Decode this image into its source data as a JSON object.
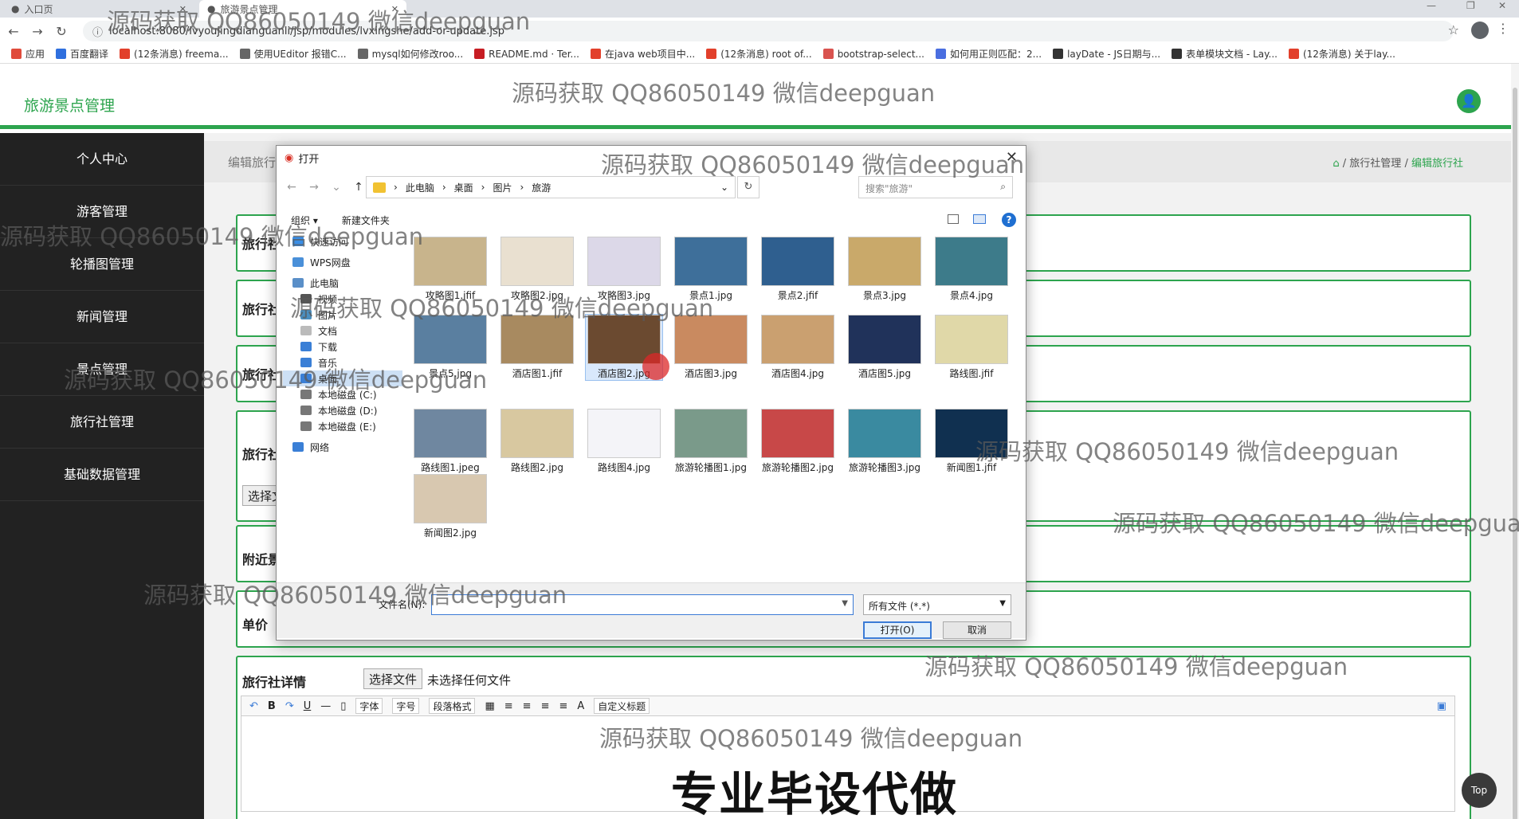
{
  "browser": {
    "tabs": [
      {
        "label": "入口页"
      },
      {
        "label": "旅游景点管理"
      }
    ],
    "url": "localhost:8080/lvyoujingdianguanli/jsp/modules/lvxingshe/add-or-update.jsp",
    "bookmarks": [
      {
        "label": "应用",
        "color": "#e04b3b"
      },
      {
        "label": "百度翻译",
        "color": "#2f6fde"
      },
      {
        "label": "(12条消息) freema...",
        "color": "#e2402b"
      },
      {
        "label": "使用UEditor 报错C...",
        "color": "#666666"
      },
      {
        "label": "mysql如何修改roo...",
        "color": "#666666"
      },
      {
        "label": "README.md · Ter...",
        "color": "#c71d23"
      },
      {
        "label": "在java web项目中...",
        "color": "#e2402b"
      },
      {
        "label": "(12条消息) root of...",
        "color": "#e2402b"
      },
      {
        "label": "bootstrap-select...",
        "color": "#d9534f"
      },
      {
        "label": "如何用正则匹配：2...",
        "color": "#4a6ee0"
      },
      {
        "label": "layDate - JS日期与...",
        "color": "#333333"
      },
      {
        "label": "表单模块文档 - Lay...",
        "color": "#333333"
      },
      {
        "label": "(12条消息) 关于lay...",
        "color": "#e2402b"
      }
    ]
  },
  "app": {
    "title": "旅游景点管理",
    "accent": "#2da44e",
    "sidebar": [
      "个人中心",
      "游客管理",
      "轮播图管理",
      "新闻管理",
      "景点管理",
      "旅行社管理",
      "基础数据管理"
    ],
    "breadcrumb_left": "编辑旅行社",
    "breadcrumb": {
      "sep": "/",
      "parent": "旅行社管理",
      "current": "编辑旅行社"
    },
    "form": {
      "labels": [
        "旅行社",
        "旅行社",
        "旅行社",
        "旅行社",
        "附近景",
        "单价",
        "旅行社详情"
      ],
      "choose_btn_short": "选择文",
      "choose_btn": "选择文件",
      "no_file": "未选择任何文件",
      "editor": {
        "font": "字体",
        "size": "字号",
        "para": "段落格式",
        "custom": "自定义标题"
      }
    },
    "top_btn": "Top",
    "promo": "专业毕设代做"
  },
  "dialog": {
    "title": "打开",
    "path": [
      "此电脑",
      "桌面",
      "图片",
      "旅游"
    ],
    "search_placeholder": "搜索\"旅游\"",
    "organize": "组织 ▾",
    "new_folder": "新建文件夹",
    "tree": [
      "快速访问",
      "WPS网盘",
      "此电脑",
      "视频",
      "图片",
      "文档",
      "下载",
      "音乐",
      "桌面",
      "本地磁盘 (C:)",
      "本地磁盘 (D:)",
      "本地磁盘 (E:)",
      "网络"
    ],
    "files": [
      {
        "name": "攻略图1.jfif",
        "color": "#c8b48c"
      },
      {
        "name": "攻略图2.jpg",
        "color": "#e9e0d0"
      },
      {
        "name": "攻略图3.jpg",
        "color": "#dcd8e8"
      },
      {
        "name": "景点1.jpg",
        "color": "#3e6f9a"
      },
      {
        "name": "景点2.jfif",
        "color": "#2f5f8f"
      },
      {
        "name": "景点3.jpg",
        "color": "#c9a96a"
      },
      {
        "name": "景点4.jpg",
        "color": "#3d7b8a"
      },
      {
        "name": "景点5.jpg",
        "color": "#5a7fa0"
      },
      {
        "name": "酒店图1.jfif",
        "color": "#a88a60"
      },
      {
        "name": "酒店图2.jpg",
        "color": "#6b4a30"
      },
      {
        "name": "酒店图3.jpg",
        "color": "#c98a60"
      },
      {
        "name": "酒店图4.jpg",
        "color": "#caa070"
      },
      {
        "name": "酒店图5.jpg",
        "color": "#20325a"
      },
      {
        "name": "路线图.jfif",
        "color": "#e0d8a8"
      },
      {
        "name": "路线图1.jpeg",
        "color": "#6f87a0"
      },
      {
        "name": "路线图2.jpg",
        "color": "#d8c8a0"
      },
      {
        "name": "路线图4.jpg",
        "color": "#f4f4f8"
      },
      {
        "name": "旅游轮播图1.jpg",
        "color": "#7a9a8a"
      },
      {
        "name": "旅游轮播图2.jpg",
        "color": "#c84848"
      },
      {
        "name": "旅游轮播图3.jpg",
        "color": "#3a8aa0"
      },
      {
        "name": "新闻图1.jfif",
        "color": "#103050"
      },
      {
        "name": "新闻图2.jpg",
        "color": "#d8c8b0"
      }
    ],
    "filename_label": "文件名(N):",
    "filetype": "所有文件 (*.*)",
    "open_btn": "打开(O)",
    "cancel_btn": "取消"
  },
  "watermark": "源码获取 QQ86050149 微信deepguan"
}
